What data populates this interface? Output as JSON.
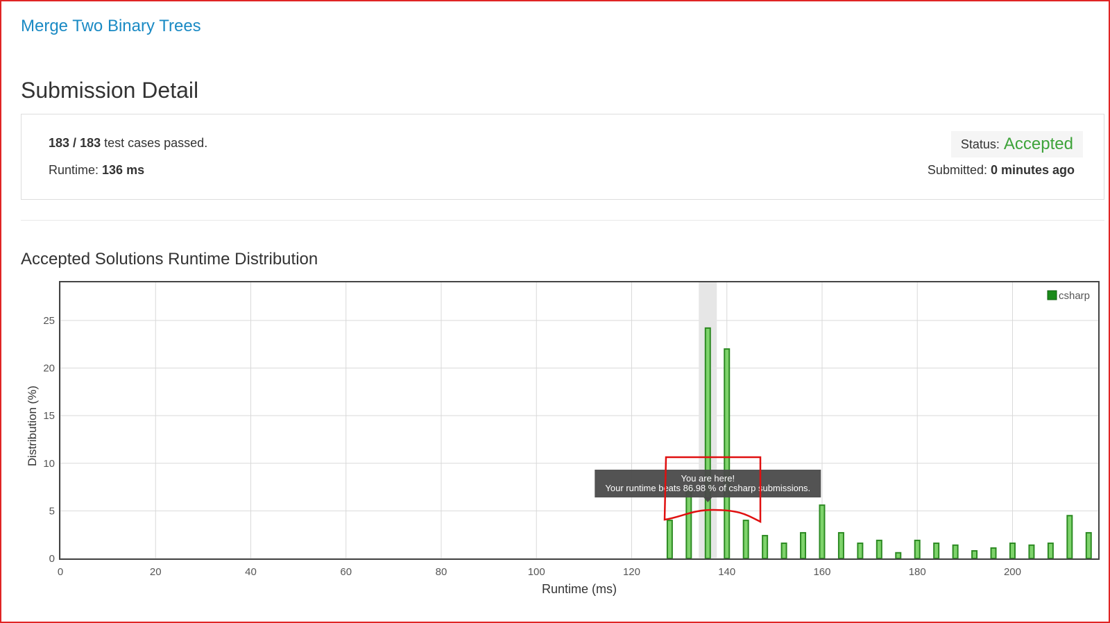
{
  "problem": {
    "title": "Merge Two Binary Trees"
  },
  "page": {
    "title": "Submission Detail"
  },
  "detail": {
    "passed": "183",
    "separator": " / ",
    "total": "183",
    "passed_suffix": " test cases passed.",
    "runtime_label": "Runtime: ",
    "runtime_value": "136 ms",
    "status_label": "Status:",
    "status_value": "Accepted",
    "submitted_label": "Submitted: ",
    "submitted_value": "0 minutes ago"
  },
  "section": {
    "title": "Accepted Solutions Runtime Distribution"
  },
  "colors": {
    "accent_link": "#1a8ac4",
    "accepted": "#3ea33a",
    "bar_fill": "#7ed36b",
    "bar_stroke": "#2c8a22",
    "legend_swatch": "#1a8a1a",
    "tooltip_bg": "#4a4a4a",
    "highlight_band": "#e6e6e6",
    "annotation": "#e01010"
  },
  "chart_data": {
    "type": "bar",
    "xlabel": "Runtime (ms)",
    "ylabel": "Distribution (%)",
    "xlim": [
      0,
      218
    ],
    "ylim": [
      0,
      29
    ],
    "xticks": [
      0,
      20,
      40,
      60,
      80,
      100,
      120,
      140,
      160,
      180,
      200
    ],
    "yticks": [
      0,
      5,
      10,
      15,
      20,
      25
    ],
    "grid": true,
    "legend_position": "top-right",
    "highlight_x": 136,
    "series": [
      {
        "name": "csharp",
        "x": [
          128,
          132,
          136,
          140,
          144,
          148,
          152,
          156,
          160,
          164,
          168,
          172,
          176,
          180,
          184,
          188,
          192,
          196,
          200,
          204,
          208,
          212,
          216
        ],
        "values": [
          4.0,
          7.5,
          24.2,
          22.0,
          4.0,
          2.4,
          1.6,
          2.7,
          5.6,
          2.7,
          1.6,
          1.9,
          0.6,
          1.9,
          1.6,
          1.4,
          0.8,
          1.1,
          1.6,
          1.4,
          1.6,
          4.5,
          2.7
        ]
      }
    ],
    "tooltip": {
      "line1": "You are here!",
      "line2": "Your runtime beats 86.98 % of csharp submissions."
    }
  }
}
